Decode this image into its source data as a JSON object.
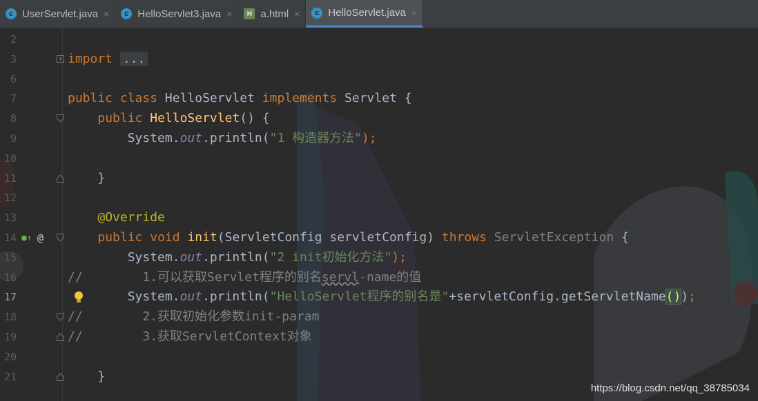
{
  "tabs": [
    {
      "icon": "class-icon",
      "label": "UserServlet.java"
    },
    {
      "icon": "class-icon",
      "label": "HelloServlet3.java"
    },
    {
      "icon": "html-file-icon",
      "label": "a.html"
    },
    {
      "icon": "class-icon",
      "label": "HelloServlet.java",
      "active": true
    }
  ],
  "tab_close_glyph": "×",
  "line_numbers": [
    "2",
    "3",
    "6",
    "7",
    "8",
    "9",
    "10",
    "11",
    "12",
    "13",
    "14",
    "15",
    "16",
    "17",
    "18",
    "19",
    "20",
    "21"
  ],
  "code": {
    "l3_kw": "import",
    "l3_fold": "...",
    "l7": {
      "kw1": "public",
      "kw2": "class",
      "name": "HelloServlet",
      "kw3": "implements",
      "iface": "Servlet",
      "brace": "{"
    },
    "l8": {
      "kw": "public",
      "fn": "HelloServlet",
      "rest": "() {"
    },
    "l9": {
      "obj": "System.",
      "field": "out",
      "call": ".println(",
      "str": "\"1 构造器方法\"",
      "end": ");"
    },
    "l11": "}",
    "l13": "@Override",
    "l14": {
      "kw1": "public",
      "kw2": "void",
      "fn": "init",
      "params": "(ServletConfig servletConfig)",
      "kw3": "throws",
      "exc": "ServletException",
      "brace": "{"
    },
    "l15": {
      "obj": "System.",
      "field": "out",
      "call": ".println(",
      "str": "\"2 init初始化方法\"",
      "end": ");"
    },
    "l16": {
      "slashes": "//",
      "text_a": "        1.可以获取Servlet程序的别名",
      "squig": "servl",
      "text_b": "-name的值"
    },
    "l17": {
      "obj": "System.",
      "field": "out",
      "call": ".println(",
      "str": "\"HelloServlet程序的别名是\"",
      "concat": "+servletConfig.getServletName",
      "paren": "()",
      "close": ")",
      "semi": ";"
    },
    "l18": "//        2.获取初始化参数init-param",
    "l19": "//        3.获取ServletContext对象",
    "l21": "}"
  },
  "gutter_icons": {
    "line14_impl": "↑",
    "line14_override": "@",
    "line17_bulb": "intention-bulb"
  },
  "colors": {
    "background": "#2b2b2b",
    "keyword": "#cc7832",
    "function": "#ffc66d",
    "string": "#6a8759",
    "field": "#9876aa",
    "annotation": "#bbb529",
    "comment": "#808080"
  },
  "watermark": "https://blog.csdn.net/qq_38785034"
}
